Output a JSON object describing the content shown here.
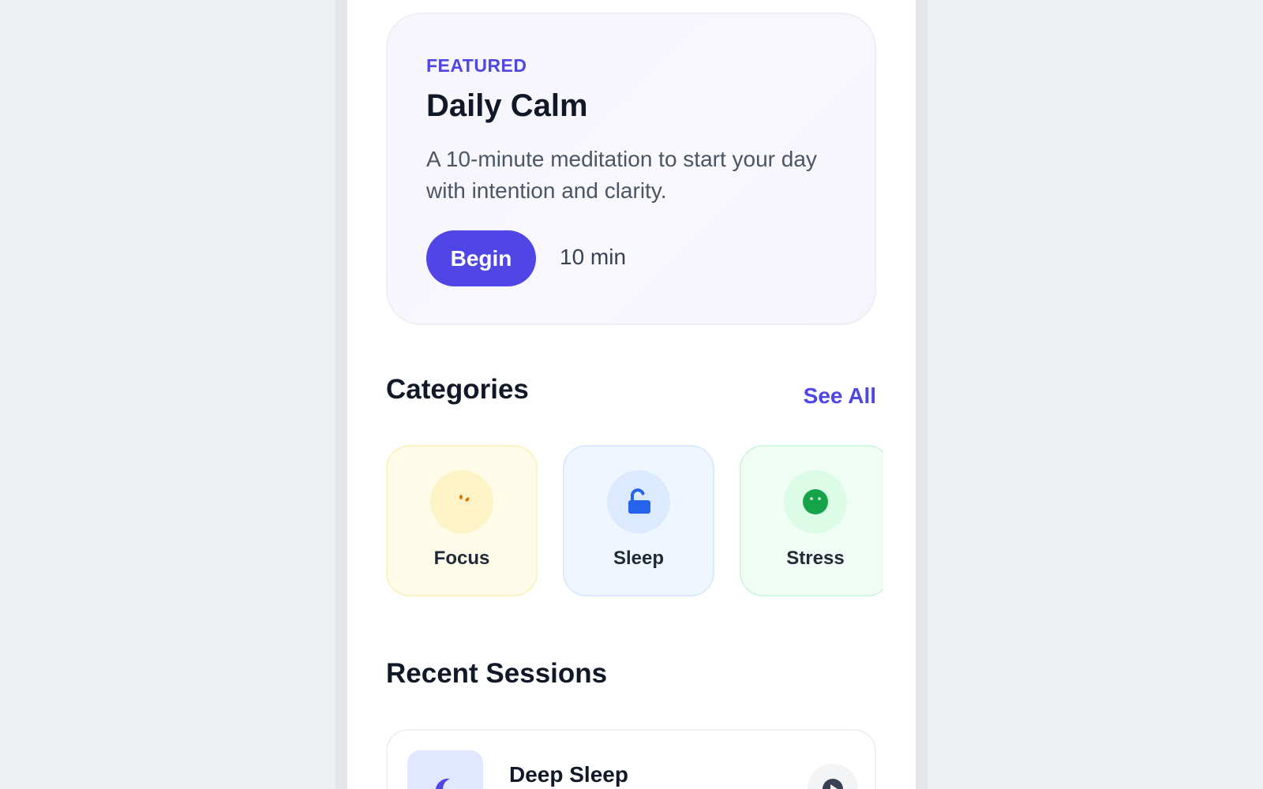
{
  "featured": {
    "eyebrow": "FEATURED",
    "title": "Daily Calm",
    "description": "A 10-minute meditation to start your day with intention and clarity.",
    "begin_label": "Begin",
    "duration": "10 min"
  },
  "categories": {
    "title": "Categories",
    "see_all": "See All",
    "items": [
      {
        "label": "Focus",
        "icon": "focus-icon",
        "color": "#d97706"
      },
      {
        "label": "Sleep",
        "icon": "unlock-icon",
        "color": "#2563eb"
      },
      {
        "label": "Stress",
        "icon": "smile-icon",
        "color": "#16a34a"
      }
    ]
  },
  "recent": {
    "title": "Recent Sessions",
    "sessions": [
      {
        "title": "Deep Sleep",
        "icon": "moon-icon"
      }
    ]
  },
  "colors": {
    "accent": "#4f46e5",
    "text": "#111827",
    "muted": "#4b5563"
  }
}
